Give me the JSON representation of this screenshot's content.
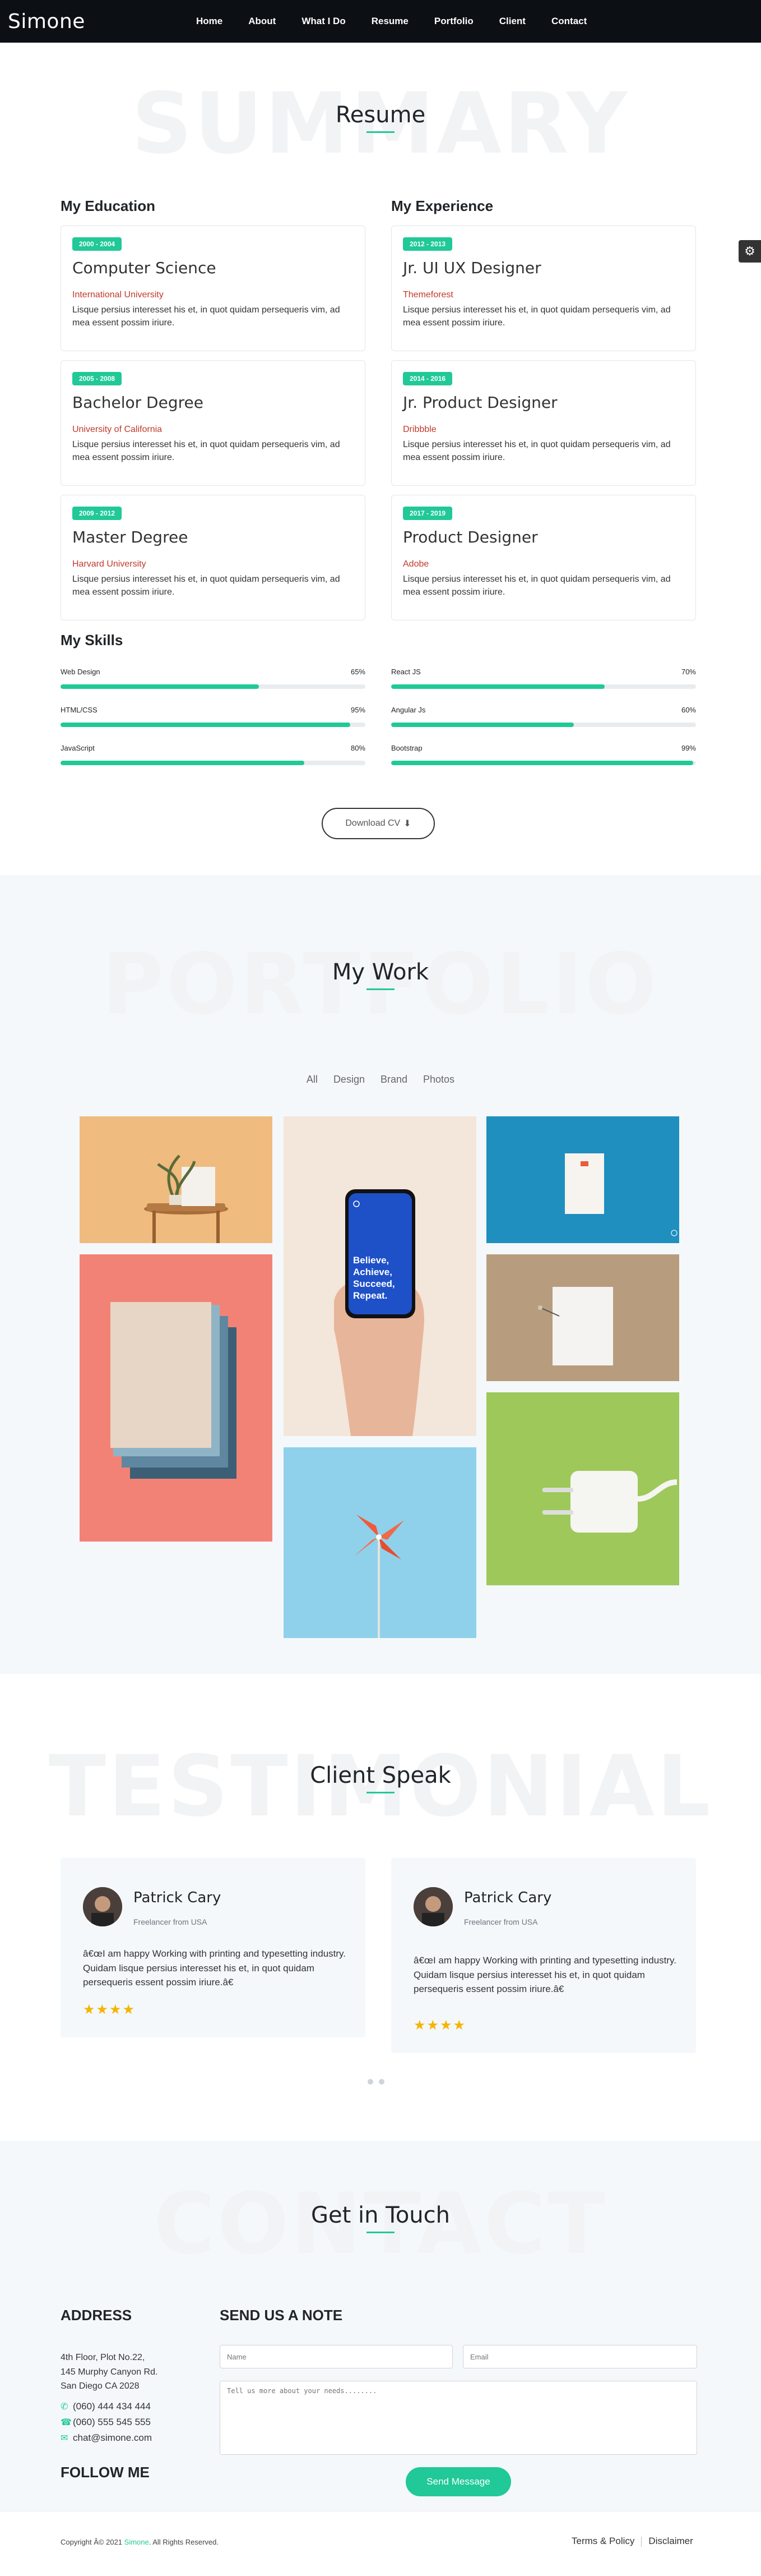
{
  "nav": {
    "brand": "Simone",
    "items": [
      "Home",
      "About",
      "What I Do",
      "Resume",
      "Portfolio",
      "Client",
      "Contact"
    ]
  },
  "resume": {
    "watermark": "SUMMARY",
    "title": "Resume",
    "education_heading": "My Education",
    "experience_heading": "My Experience",
    "education": [
      {
        "years": "2000 - 2004",
        "title": "Computer Science",
        "org": "International University",
        "desc": "Lisque persius interesset his et, in quot quidam persequeris vim, ad mea essent possim iriure."
      },
      {
        "years": "2005 - 2008",
        "title": "Bachelor Degree",
        "org": "University of California",
        "desc": "Lisque persius interesset his et, in quot quidam persequeris vim, ad mea essent possim iriure."
      },
      {
        "years": "2009 - 2012",
        "title": "Master Degree",
        "org": "Harvard University",
        "desc": "Lisque persius interesset his et, in quot quidam persequeris vim, ad mea essent possim iriure."
      }
    ],
    "experience": [
      {
        "years": "2012 - 2013",
        "title": "Jr. UI UX Designer",
        "org": "Themeforest",
        "desc": "Lisque persius interesset his et, in quot quidam persequeris vim, ad mea essent possim iriure."
      },
      {
        "years": "2014 - 2016",
        "title": "Jr. Product Designer",
        "org": "Dribbble",
        "desc": "Lisque persius interesset his et, in quot quidam persequeris vim, ad mea essent possim iriure."
      },
      {
        "years": "2017 - 2019",
        "title": "Product Designer",
        "org": "Adobe",
        "desc": "Lisque persius interesset his et, in quot quidam persequeris vim, ad mea essent possim iriure."
      }
    ],
    "skills_heading": "My Skills",
    "skills": [
      {
        "name": "Web Design",
        "percent": 65,
        "label": "65%"
      },
      {
        "name": "React JS",
        "percent": 70,
        "label": "70%"
      },
      {
        "name": "HTML/CSS",
        "percent": 95,
        "label": "95%"
      },
      {
        "name": "Angular Js",
        "percent": 60,
        "label": "60%"
      },
      {
        "name": "JavaScript",
        "percent": 80,
        "label": "80%"
      },
      {
        "name": "Bootstrap",
        "percent": 99,
        "label": "99%"
      }
    ],
    "download_label": "Download CV"
  },
  "portfolio": {
    "watermark": "PORTFOLIO",
    "title": "My Work",
    "filters": [
      "All",
      "Design",
      "Brand",
      "Photos"
    ],
    "phone_text": "Believe, Achieve, Succeed, Repeat."
  },
  "testimonial": {
    "watermark": "TESTIMONIAL",
    "title": "Client Speak",
    "items": [
      {
        "name": "Patrick Cary",
        "from": "Freelancer from USA",
        "quote": "â€œI am happy Working with printing and typesetting industry. Quidam lisque persius interesset his et, in quot quidam persequeris essent possim iriure.â€",
        "stars": "★★★★"
      },
      {
        "name": "Patrick Cary",
        "from": "Freelancer from USA",
        "quote": "â€œI am happy Working with printing and typesetting industry. Quidam lisque persius interesset his et, in quot quidam persequeris essent possim iriure.â€",
        "stars": "★★★★"
      }
    ]
  },
  "contact": {
    "watermark": "CONTACT",
    "title": "Get in Touch",
    "address_heading": "ADDRESS",
    "address_lines": [
      "4th Floor, Plot No.22,",
      "145 Murphy Canyon Rd.",
      "San Diego CA 2028"
    ],
    "phone1": "(060) 444 434 444",
    "phone2": "(060) 555 545 555",
    "email": "chat@simone.com",
    "follow_heading": "FOLLOW ME",
    "note_heading": "SEND US A NOTE",
    "name_placeholder": "Name",
    "email_placeholder": "Email",
    "message_placeholder": "Tell us more about your needs........",
    "send_label": "Send Message"
  },
  "footer": {
    "copyright_prefix": "Copyright Â© 2021",
    "brand": "Simone",
    "copyright_suffix": ". All Rights Reserved.",
    "terms": "Terms & Policy",
    "disclaimer": "Disclaimer"
  },
  "colors": {
    "accent": "#20c997",
    "nav_bg": "#0c0f14",
    "org_red": "#c0392b",
    "light_bg": "#f5f8fb"
  }
}
